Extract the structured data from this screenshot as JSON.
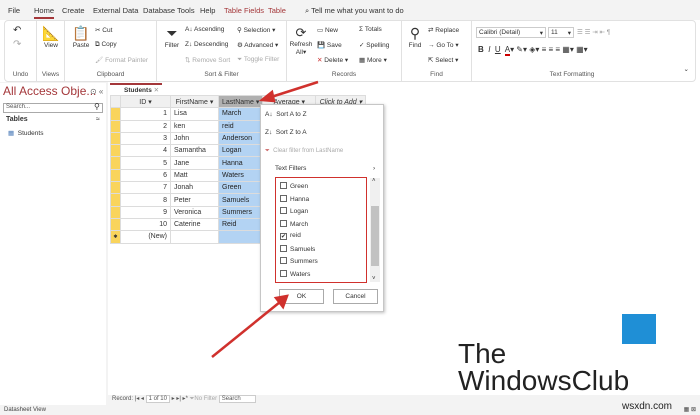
{
  "tabs": [
    "File",
    "Home",
    "Create",
    "External Data",
    "Database Tools",
    "Help",
    "Table Fields",
    "Table"
  ],
  "tell_me": "Tell me what you want to do",
  "ribbon": {
    "undo": "Undo",
    "views": "Views",
    "view": "View",
    "clipboard": {
      "label": "Clipboard",
      "paste": "Paste",
      "cut": "Cut",
      "copy": "Copy",
      "format_painter": "Format Painter"
    },
    "sort_filter": {
      "label": "Sort & Filter",
      "filter": "Filter",
      "ascending": "Ascending",
      "descending": "Descending",
      "remove_sort": "Remove Sort",
      "selection": "Selection",
      "advanced": "Advanced",
      "toggle_filter": "Toggle Filter"
    },
    "records": {
      "label": "Records",
      "refresh": "Refresh",
      "all": "All",
      "new": "New",
      "save": "Save",
      "delete": "Delete",
      "totals": "Totals",
      "spelling": "Spelling",
      "more": "More"
    },
    "find": {
      "label": "Find",
      "find": "Find",
      "replace": "Replace",
      "goto": "Go To",
      "select": "Select"
    },
    "text_formatting": {
      "label": "Text Formatting",
      "font": "Calibri (Detail)",
      "size": "11"
    }
  },
  "nav": {
    "title": "All Access Obje...",
    "search_placeholder": "Search...",
    "section": "Tables",
    "items": [
      "Students"
    ]
  },
  "doc_tab": "Students",
  "table": {
    "columns": [
      "ID",
      "FirstName",
      "LastName",
      "Average",
      "Click to Add"
    ],
    "rows": [
      [
        1,
        "Lisa",
        "March"
      ],
      [
        2,
        "ken",
        "reid"
      ],
      [
        3,
        "John",
        "Anderson"
      ],
      [
        4,
        "Samantha",
        "Logan"
      ],
      [
        5,
        "Jane",
        "Hanna"
      ],
      [
        6,
        "Matt",
        "Waters"
      ],
      [
        7,
        "Jonah",
        "Green"
      ],
      [
        8,
        "Peter",
        "Samuels"
      ],
      [
        9,
        "Veronica",
        "Summers"
      ],
      [
        10,
        "Caterine",
        "Reid"
      ]
    ],
    "new_row": "(New)"
  },
  "filter_menu": {
    "sort_az": "Sort A to Z",
    "sort_za": "Sort Z to A",
    "clear": "Clear filter from LastName",
    "text_filters": "Text Filters",
    "values": [
      {
        "label": "Green",
        "checked": false
      },
      {
        "label": "Hanna",
        "checked": false
      },
      {
        "label": "Logan",
        "checked": false
      },
      {
        "label": "March",
        "checked": false
      },
      {
        "label": "reid",
        "checked": true
      },
      {
        "label": "Samuels",
        "checked": false
      },
      {
        "label": "Summers",
        "checked": false
      },
      {
        "label": "Waters",
        "checked": false
      }
    ],
    "ok": "OK",
    "cancel": "Cancel"
  },
  "record_bar": {
    "label": "Record:",
    "position": "1 of 10",
    "no_filter": "No Filter",
    "search": "Search"
  },
  "status": "Datasheet View",
  "watermark": {
    "line1": "The",
    "line2": "WindowsClub"
  },
  "site": "wsxdn.com",
  "colors": {
    "accent": "#a4373a",
    "highlight": "#b3d3f3",
    "annotation": "#d0312d"
  }
}
